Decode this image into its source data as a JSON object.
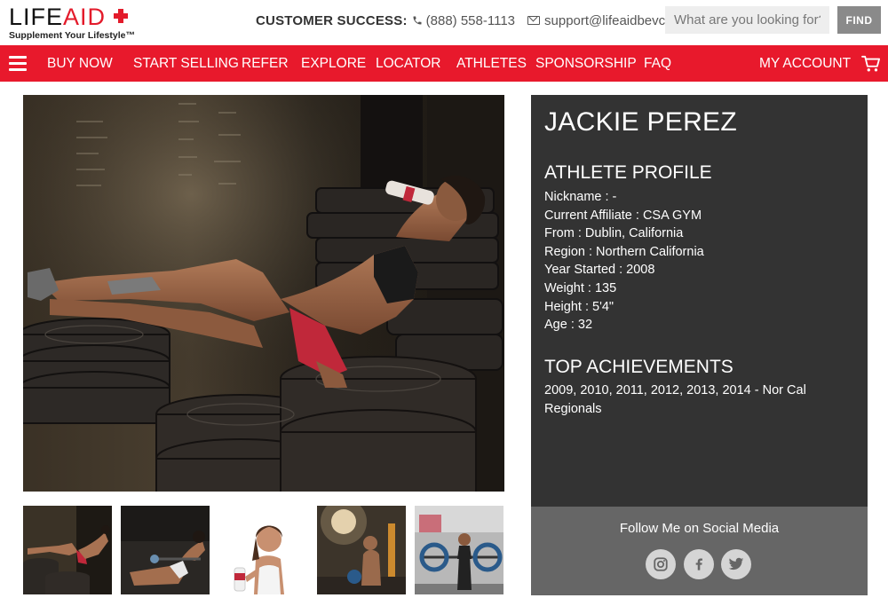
{
  "brand": {
    "logo_life": "LIFE",
    "logo_aid": "AID",
    "tagline": "Supplement Your Lifestyle™",
    "accent_color": "#e8192c"
  },
  "header": {
    "customer_success_label": "CUSTOMER SUCCESS:",
    "phone": "(888) 558-1113",
    "email": "support@lifeaidbevco.com",
    "search_placeholder": "What are you looking for?",
    "find_label": "FIND"
  },
  "nav": {
    "items": [
      {
        "label": "BUY NOW"
      },
      {
        "label": "START SELLING"
      },
      {
        "label": "REFER"
      },
      {
        "label": "EXPLORE"
      },
      {
        "label": "LOCATOR"
      },
      {
        "label": "ATHLETES"
      },
      {
        "label": "SPONSORSHIP"
      },
      {
        "label": "FAQ"
      }
    ],
    "account_label": "MY ACCOUNT",
    "menu_icon": "hamburger-icon",
    "cart_icon": "cart-icon"
  },
  "profile": {
    "name": "JACKIE PEREZ",
    "profile_heading": "ATHLETE PROFILE",
    "details": [
      "Nickname : -",
      "Current Affiliate : CSA GYM",
      "From : Dublin, California",
      "Region : Northern California",
      "Year Started : 2008",
      "Weight : 135",
      "Height : 5'4\"",
      "Age : 32"
    ],
    "achievements_heading": "TOP ACHIEVEMENTS",
    "achievements_text": "2009, 2010, 2011, 2012, 2013, 2014 - Nor Cal Regionals"
  },
  "social": {
    "title": "Follow Me on Social Media",
    "icons": [
      "instagram-icon",
      "facebook-icon",
      "twitter-icon"
    ]
  },
  "gallery": {
    "thumbnail_count": 5
  }
}
